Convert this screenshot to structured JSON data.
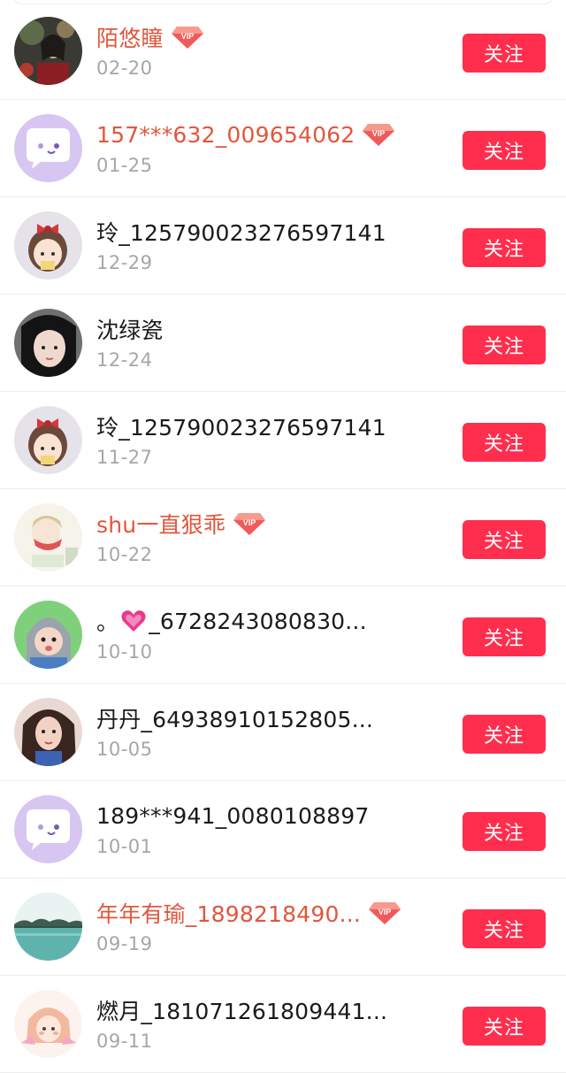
{
  "follow_label": "关注",
  "colors": {
    "button": "#ff2e4d",
    "vip_name": "#e0573d",
    "date": "#a6a6a6",
    "name": "#1a1a1a"
  },
  "users": [
    {
      "name": "陌悠瞳",
      "date": "02-20",
      "vip": true,
      "avatar": "photo-dark-woman"
    },
    {
      "name": "157***632_009654062",
      "date": "01-25",
      "vip": true,
      "avatar": "default-chat"
    },
    {
      "name": "玲_125790023276597141",
      "date": "12-29",
      "vip": false,
      "avatar": "cartoon-girl-bow"
    },
    {
      "name": "沈绿瓷",
      "date": "12-24",
      "vip": false,
      "avatar": "photo-girl"
    },
    {
      "name": "玲_125790023276597141",
      "date": "11-27",
      "vip": false,
      "avatar": "cartoon-girl-bow"
    },
    {
      "name": "shu一直狠乖",
      "date": "10-22",
      "vip": true,
      "avatar": "sketch-girl"
    },
    {
      "name_prefix": "。",
      "name": "_6728243080830...",
      "date": "10-10",
      "vip": false,
      "avatar": "photo-baby",
      "heart": true
    },
    {
      "name": "丹丹_64938910152805...",
      "date": "10-05",
      "vip": false,
      "avatar": "photo-woman"
    },
    {
      "name": "189***941_0080108897",
      "date": "10-01",
      "vip": false,
      "avatar": "default-chat"
    },
    {
      "name": "年年有瑜_1898218490...",
      "date": "09-19",
      "vip": true,
      "avatar": "photo-lake"
    },
    {
      "name": "燃月_181071261809441...",
      "date": "09-11",
      "vip": false,
      "avatar": "cartoon-girl-pink"
    }
  ]
}
